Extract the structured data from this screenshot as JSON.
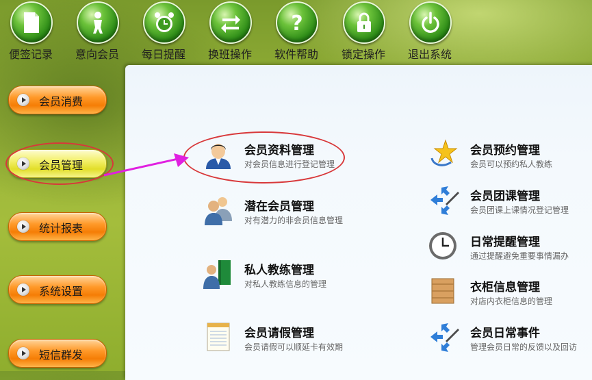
{
  "toolbar": {
    "items": [
      {
        "label": "便签记录",
        "icon": "note-icon"
      },
      {
        "label": "意向会员",
        "icon": "person-icon"
      },
      {
        "label": "每日提醒",
        "icon": "alarm-clock-icon"
      },
      {
        "label": "换班操作",
        "icon": "swap-arrows-icon"
      },
      {
        "label": "软件帮助",
        "icon": "help-icon"
      },
      {
        "label": "锁定操作",
        "icon": "lock-icon"
      },
      {
        "label": "退出系统",
        "icon": "power-icon"
      }
    ]
  },
  "sidebar": {
    "items": [
      {
        "label": "会员消费",
        "active": false
      },
      {
        "label": "会员管理",
        "active": true
      },
      {
        "label": "统计报表",
        "active": false
      },
      {
        "label": "系统设置",
        "active": false
      },
      {
        "label": "短信群发",
        "active": false
      }
    ]
  },
  "main": {
    "left": [
      {
        "title": "会员资料管理",
        "desc": "对会员信息进行登记管理",
        "icon": "member-avatar-icon"
      },
      {
        "title": "潜在会员管理",
        "desc": "对有潜力的非会员信息管理",
        "icon": "users-group-icon"
      },
      {
        "title": "私人教练管理",
        "desc": "对私人教练信息的管理",
        "icon": "trainer-book-icon"
      },
      {
        "title": "会员请假管理",
        "desc": "会员请假可以顺延卡有效期",
        "icon": "notepad-icon"
      }
    ],
    "right": [
      {
        "title": "会员预约管理",
        "desc": "会员可以预约私人教练",
        "icon": "star-icon"
      },
      {
        "title": "会员团课管理",
        "desc": "会员团课上课情况登记管理",
        "icon": "arrows-pen-icon"
      },
      {
        "title": "日常提醒管理",
        "desc": "通过提醒避免重要事情漏办",
        "icon": "clock-icon"
      },
      {
        "title": "衣柜信息管理",
        "desc": "对店内衣柜信息的管理",
        "icon": "wooden-crate-icon"
      },
      {
        "title": "会员日常事件",
        "desc": "管理会员日常的反馈以及回访",
        "icon": "arrows-pen-icon"
      }
    ]
  },
  "colors": {
    "annotation": "#d8383a",
    "arrow": "#e020e0",
    "side_button": "#f57d05",
    "side_button_active": "#e2de2a"
  }
}
